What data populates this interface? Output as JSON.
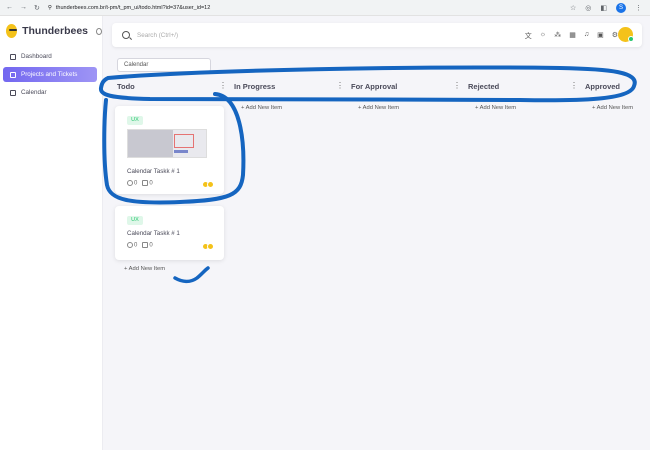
{
  "browser": {
    "url": "thunderbees.com.br/t-pm/t_pm_ui/todo.html?id=37&user_id=12",
    "profile_initial": "S"
  },
  "sidebar": {
    "brand": "Thunderbees",
    "items": [
      {
        "label": "Dashboard",
        "icon": "home-icon"
      },
      {
        "label": "Projects and Tickets",
        "icon": "projects-icon",
        "active": true
      },
      {
        "label": "Calendar",
        "icon": "calendar-icon"
      }
    ]
  },
  "search": {
    "placeholder": "Search (Ctrl+/)"
  },
  "topbar": {
    "icons": [
      "translate-icon",
      "sun-icon",
      "magic-icon",
      "grid-icon",
      "bell-icon",
      "calendar-icon",
      "settings-icon"
    ]
  },
  "project_select": {
    "value": "Calendar"
  },
  "board": {
    "columns": [
      {
        "name": "Todo",
        "add_label": ""
      },
      {
        "name": "In Progress",
        "add_label": "+ Add New Item"
      },
      {
        "name": "For Approval",
        "add_label": "+ Add New Item"
      },
      {
        "name": "Rejected",
        "add_label": "+ Add New Item"
      },
      {
        "name": "Approved",
        "add_label": "+ Add New Item"
      }
    ],
    "cards": [
      {
        "tag": "UX",
        "title": "Calendar Taskk # 1",
        "attachments": "0",
        "comments": "0"
      },
      {
        "tag": "UX",
        "title": "Calendar Taskk # 1",
        "attachments": "0",
        "comments": "0"
      }
    ],
    "todo_add_label": "+ Add New Item"
  },
  "colors": {
    "accent": "#7367f0",
    "annotation": "#1565c0",
    "success": "#28c76f"
  }
}
